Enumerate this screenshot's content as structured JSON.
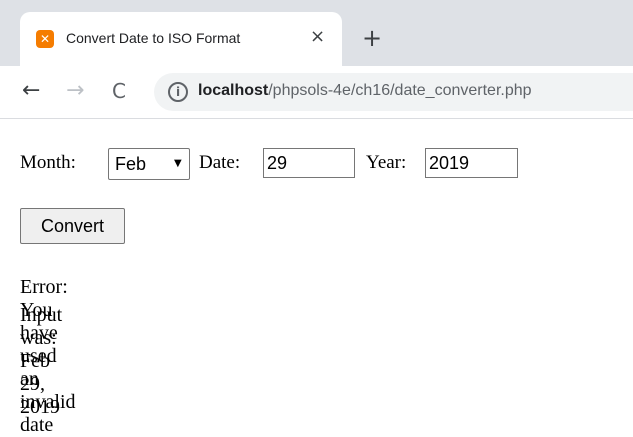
{
  "browser": {
    "tab_title": "Convert Date to ISO Format",
    "favicon": "xampp-icon",
    "close_glyph": "×",
    "new_tab_glyph": "+",
    "back_glyph": "←",
    "forward_glyph": "→",
    "reload_glyph": "C",
    "info_glyph": "i",
    "url_host": "localhost",
    "url_path": "/phpsols-4e/ch16/date_converter.php"
  },
  "form": {
    "month_label": "Month:",
    "month_selected": "Feb",
    "date_label": "Date:",
    "date_value": "29",
    "year_label": "Year:",
    "year_value": "2019",
    "convert_label": "Convert"
  },
  "result": {
    "error_text": "Error: You have used an invalid date",
    "input_text": "Input was: Feb 29, 2019"
  }
}
